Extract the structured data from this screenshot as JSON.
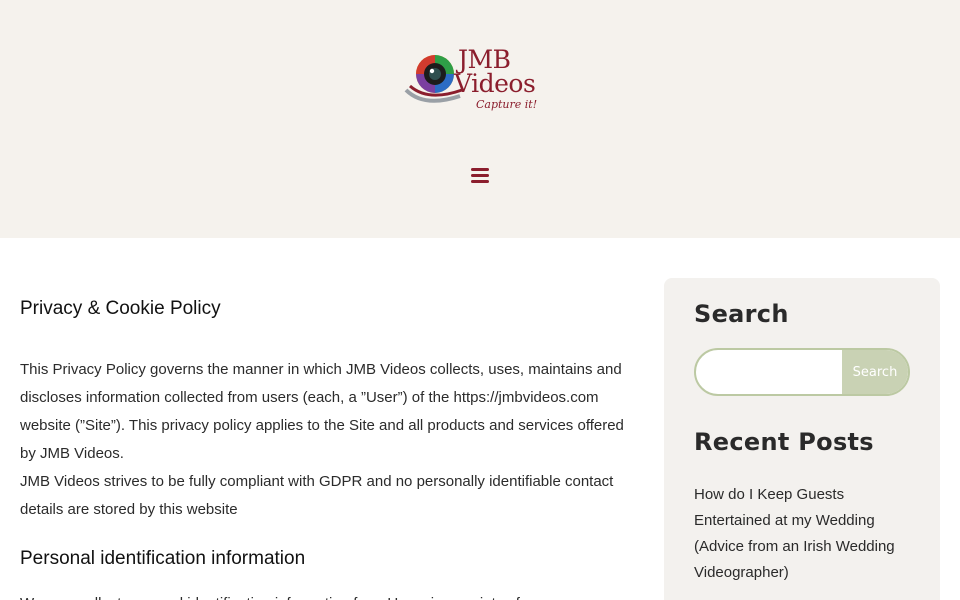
{
  "header": {
    "logo": {
      "line1": "JMB",
      "line2": "Videos",
      "tagline": "Capture it!",
      "icon": "camera-lens-icon"
    },
    "menu_icon": "hamburger-menu-icon",
    "background": "#f5f2ed",
    "brand_color": "#8b1e2d"
  },
  "main": {
    "title": "Privacy & Cookie Policy",
    "paragraph1": "This Privacy Policy governs the manner in which JMB Videos collects, uses, maintains and discloses information collected from users (each, a ”User”) of the https://jmbvideos.com website (”Site”). This privacy policy applies to the Site and all products and services offered by JMB Videos.",
    "paragraph2": "JMB Videos strives to be fully compliant with GDPR and no personally identifiable contact details are stored by this website",
    "section_heading": "Personal identification information",
    "paragraph3": "We may collect personal identification information from Users in a variety of ways"
  },
  "sidebar": {
    "search": {
      "title": "Search",
      "input_value": "",
      "button_label": "Search"
    },
    "recent_posts": {
      "title": "Recent Posts",
      "items": [
        "How do I Keep Guests Entertained at my Wedding (Advice from an Irish Wedding Videographer)"
      ]
    },
    "accent": "#c9d2b4"
  }
}
